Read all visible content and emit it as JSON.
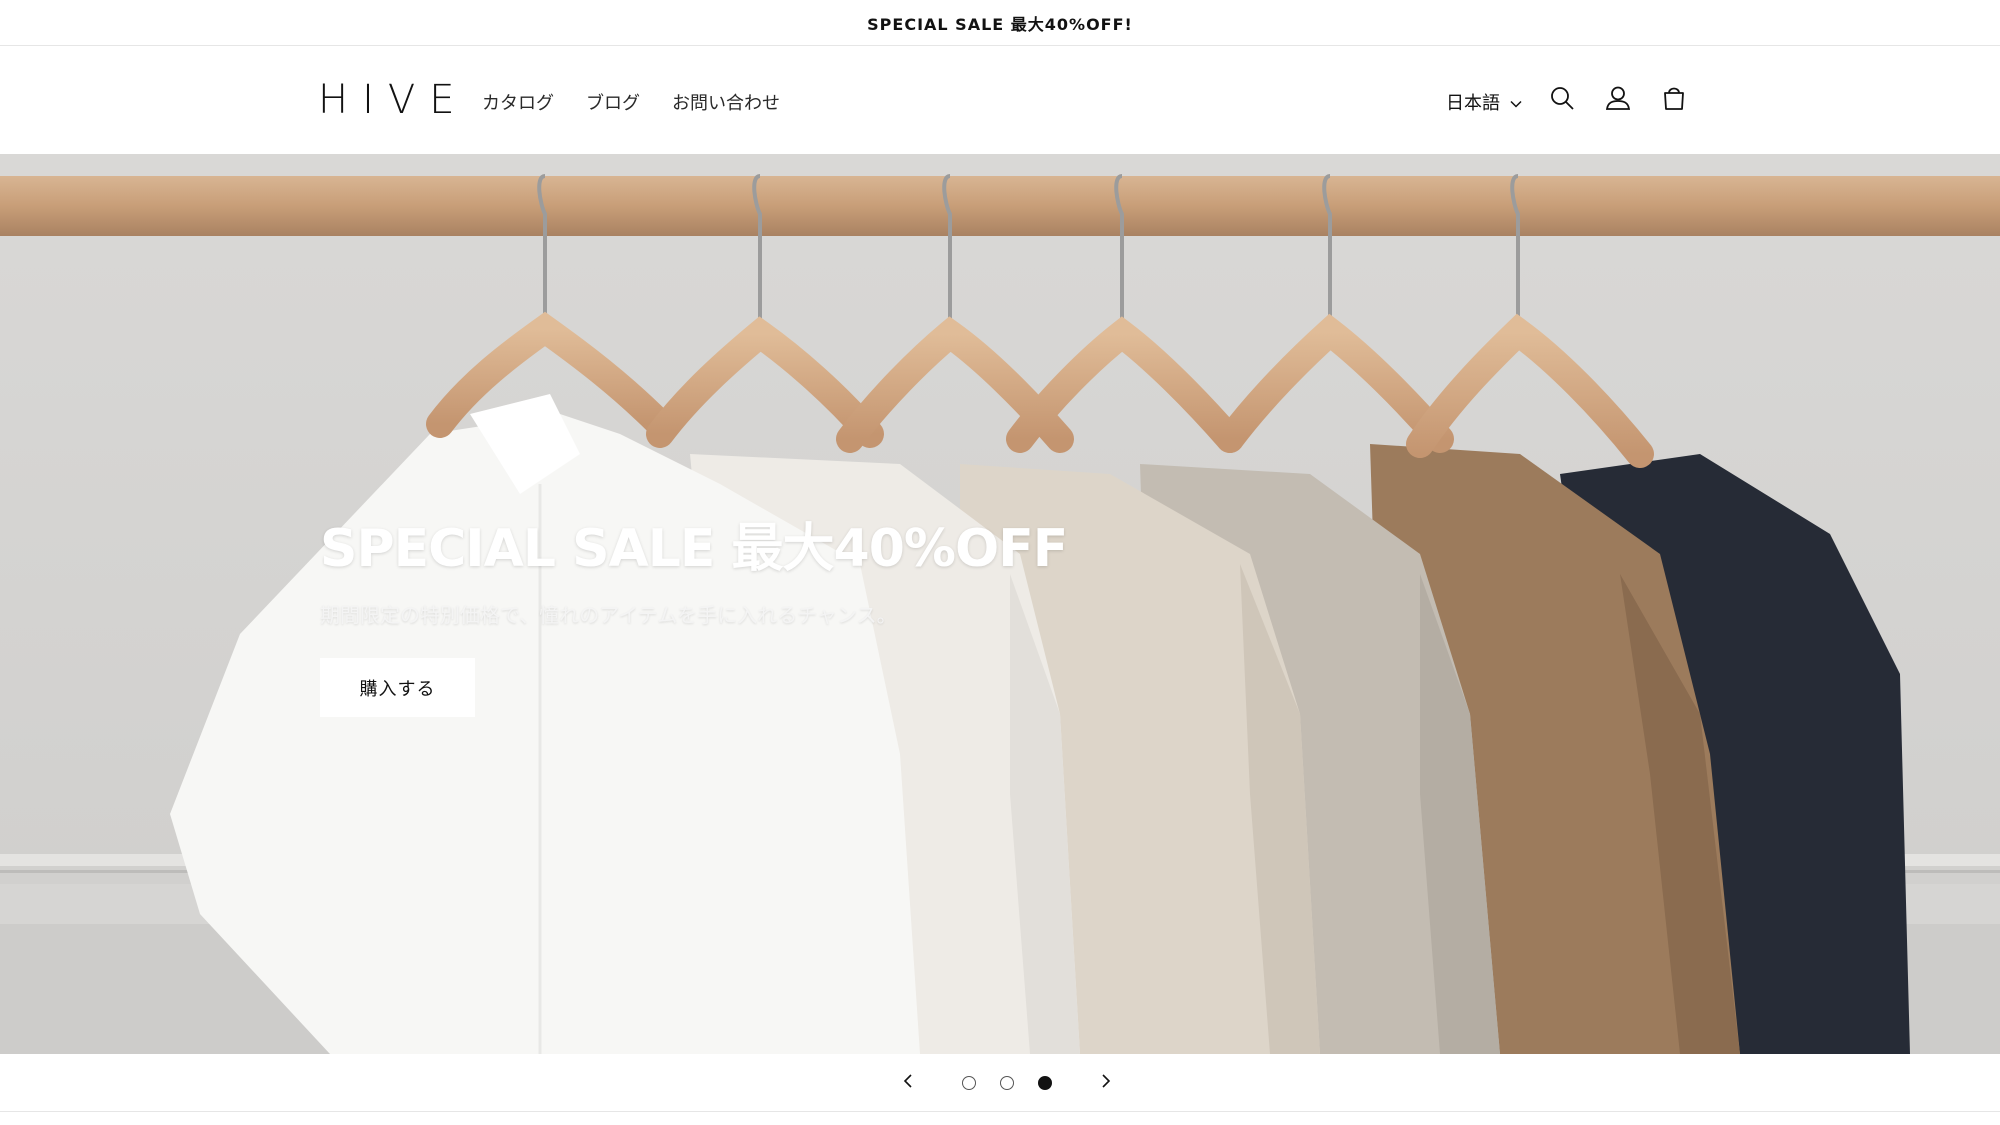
{
  "announcement": {
    "text": "SPECIAL SALE 最大40%OFF!"
  },
  "header": {
    "logo": "HIVE",
    "nav": [
      {
        "label": "カタログ"
      },
      {
        "label": "ブログ"
      },
      {
        "label": "お問い合わせ"
      }
    ],
    "language": {
      "selected": "日本語",
      "icon": "chevron-down-icon"
    },
    "icons": [
      "search-icon",
      "account-icon",
      "cart-icon"
    ]
  },
  "hero": {
    "title": "SPECIAL SALE 最大40%OFF",
    "subtitle": "期間限定の特別価格で、憧れのアイテムを手に入れるチャンス。",
    "button_label": "購入する"
  },
  "slider": {
    "slides_count": 3,
    "active_slide": 3,
    "prev_icon": "chevron-left-icon",
    "next_icon": "chevron-right-icon"
  },
  "colors": {
    "text": "#121212",
    "background": "#ffffff",
    "hero_wall": "#d7d6d4",
    "rail_wood": "#c9a27e"
  }
}
